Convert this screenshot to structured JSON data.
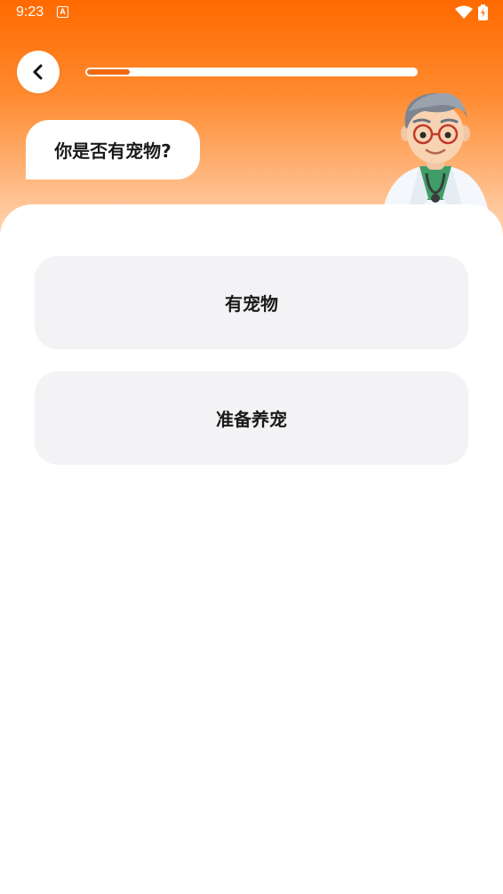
{
  "status_bar": {
    "time": "9:23",
    "app_icon_letter": "A",
    "icons": [
      "wifi-icon",
      "battery-charging-icon"
    ]
  },
  "header": {
    "back_icon": "chevron-left-icon",
    "progress_fraction": 0.13
  },
  "question": {
    "text": "你是否有宠物?"
  },
  "mascot": {
    "icon": "doctor-avatar"
  },
  "options": [
    {
      "label": "有宠物"
    },
    {
      "label": "准备养宠"
    }
  ],
  "colors": {
    "accent": "#ff6a00",
    "progress_fill": "#f06a0b",
    "option_bg": "#f3f3f5",
    "text": "#1a1a1a"
  }
}
